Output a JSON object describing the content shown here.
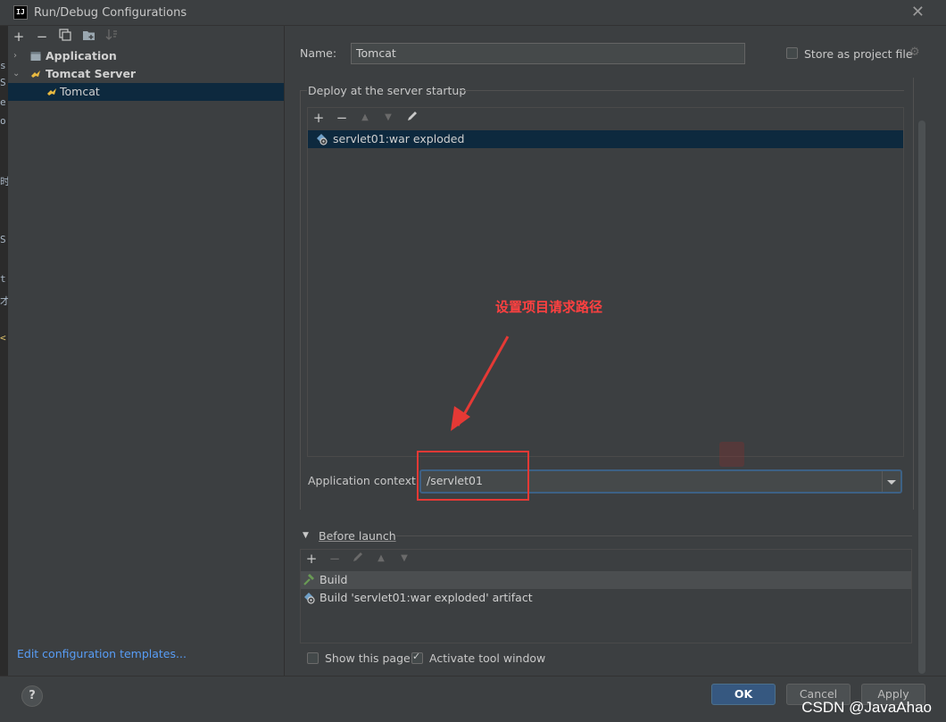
{
  "window": {
    "title": "Run/Debug Configurations",
    "logo_text": "IJ"
  },
  "background_editor": {
    "fragments": [
      "s",
      "S",
      "e",
      "o",
      "时",
      "S",
      "t",
      "才",
      "<"
    ]
  },
  "left": {
    "toolbar": [
      "add-icon",
      "remove-icon",
      "copy-icon",
      "folder-icon",
      "sort-icon"
    ],
    "tree": [
      {
        "label": "Application",
        "expanded": false,
        "bold": true
      },
      {
        "label": "Tomcat Server",
        "expanded": true,
        "bold": true
      },
      {
        "label": "Tomcat",
        "selected": true
      }
    ],
    "edit_templates_link": "Edit configuration templates..."
  },
  "form": {
    "name_label": "Name:",
    "name_value": "Tomcat",
    "store_label": "Store as project file",
    "store_checked": false,
    "deploy_group_title": "Deploy at the server startup",
    "deploy_items": [
      {
        "label": "servlet01:war exploded",
        "selected": true
      }
    ],
    "app_context_label": "Application context:",
    "app_context_value": "/servlet01",
    "before_launch_title": "Before launch",
    "before_launch_items": [
      {
        "label": "Build",
        "icon": "hammer-icon",
        "selected": true
      },
      {
        "label": "Build 'servlet01:war exploded' artifact",
        "icon": "artifact-icon",
        "selected": false
      }
    ],
    "show_page_label": "Show this page",
    "show_page_checked": false,
    "activate_tool_label": "Activate tool window",
    "activate_tool_checked": true
  },
  "annotation": {
    "text": "设置项目请求路径",
    "color": "#e53935"
  },
  "buttons": {
    "help": "?",
    "ok": "OK",
    "cancel": "Cancel",
    "apply": "Apply"
  },
  "watermark": "CSDN @JavaAhao",
  "colors": {
    "selection": "#0d293e",
    "link": "#589df6",
    "primary_button": "#365880"
  }
}
